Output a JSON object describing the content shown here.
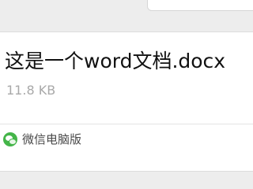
{
  "file_message": {
    "file_name": "这是一个word文档.docx",
    "file_size": "11.8 KB",
    "source_label": "微信电脑版",
    "source_icon": "wechat-icon"
  },
  "colors": {
    "card_background": "#ffffff",
    "page_background": "#ededed",
    "file_size_text": "#a9a9a9",
    "wechat_green": "#44b549"
  }
}
